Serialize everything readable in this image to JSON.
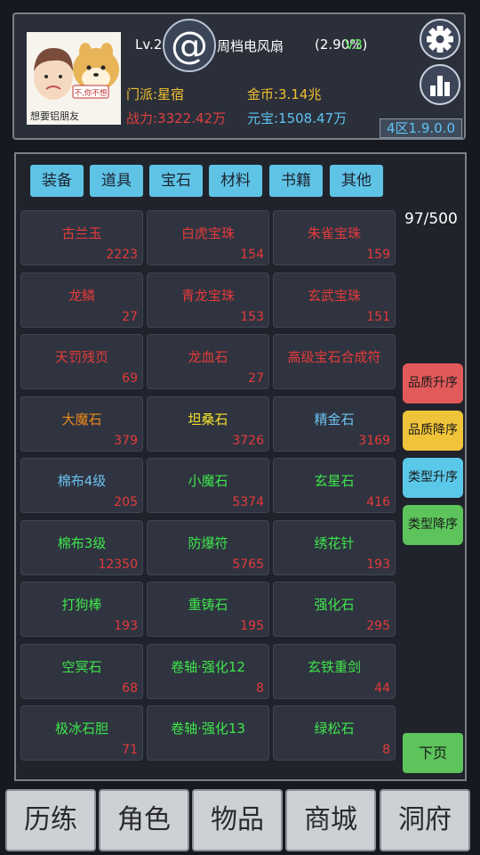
{
  "header": {
    "avatar_caption": "想要铝朋友",
    "avatar_sign": "不,你不想",
    "at_symbol": "@",
    "level": "Lv.2",
    "item_name": "周档电风扇",
    "item_pct": "(2.90%)",
    "vip": "V3",
    "sect": "门派:星宿",
    "gold": "金币:3.14兆",
    "power": "战力:3322.42万",
    "yuanbao": "元宝:1508.47万",
    "version": "4区1.9.0.0",
    "settings_icon": "gear-icon",
    "stats_icon": "bar-chart-icon"
  },
  "tabs": [
    "装备",
    "道具",
    "宝石",
    "材料",
    "书籍",
    "其他"
  ],
  "capacity": "97/500",
  "items": [
    {
      "name": "古兰玉",
      "count": "2223",
      "quality": "red"
    },
    {
      "name": "白虎宝珠",
      "count": "154",
      "quality": "red"
    },
    {
      "name": "朱雀宝珠",
      "count": "159",
      "quality": "red"
    },
    {
      "name": "龙鳞",
      "count": "27",
      "quality": "red"
    },
    {
      "name": "青龙宝珠",
      "count": "153",
      "quality": "red"
    },
    {
      "name": "玄武宝珠",
      "count": "151",
      "quality": "red"
    },
    {
      "name": "天罚残页",
      "count": "69",
      "quality": "red"
    },
    {
      "name": "龙血石",
      "count": "27",
      "quality": "red"
    },
    {
      "name": "高级宝石合成符",
      "count": "",
      "quality": "red"
    },
    {
      "name": "大魔石",
      "count": "379",
      "quality": "orange"
    },
    {
      "name": "坦桑石",
      "count": "3726",
      "quality": "yellow"
    },
    {
      "name": "精金石",
      "count": "3169",
      "quality": "blue"
    },
    {
      "name": "棉布4级",
      "count": "205",
      "quality": "blue"
    },
    {
      "name": "小魔石",
      "count": "5374",
      "quality": "green"
    },
    {
      "name": "玄星石",
      "count": "416",
      "quality": "green"
    },
    {
      "name": "棉布3级",
      "count": "12350",
      "quality": "green"
    },
    {
      "name": "防爆符",
      "count": "5765",
      "quality": "green"
    },
    {
      "name": "绣花针",
      "count": "193",
      "quality": "green"
    },
    {
      "name": "打狗棒",
      "count": "193",
      "quality": "green"
    },
    {
      "name": "重铸石",
      "count": "195",
      "quality": "green"
    },
    {
      "name": "强化石",
      "count": "295",
      "quality": "green"
    },
    {
      "name": "空冥石",
      "count": "68",
      "quality": "green"
    },
    {
      "name": "卷轴·强化12",
      "count": "8",
      "quality": "green"
    },
    {
      "name": "玄铁重剑",
      "count": "44",
      "quality": "green"
    },
    {
      "name": "极冰石胆",
      "count": "71",
      "quality": "green"
    },
    {
      "name": "卷轴·强化13",
      "count": "",
      "quality": "green"
    },
    {
      "name": "绿松石",
      "count": "8",
      "quality": "green"
    }
  ],
  "sort_buttons": [
    {
      "label": "品质升序",
      "color": "#e35a5a"
    },
    {
      "label": "品质降序",
      "color": "#f0c43a"
    },
    {
      "label": "类型升序",
      "color": "#5ac8e8"
    },
    {
      "label": "类型降序",
      "color": "#5cc45a"
    }
  ],
  "next_page": "下页",
  "nav": [
    "历练",
    "角色",
    "物品",
    "商城",
    "洞府"
  ],
  "colors": {
    "quality_red": "#e53a3a",
    "quality_orange": "#ef8a1c",
    "quality_yellow": "#f3e02a",
    "quality_blue": "#6cc3f0",
    "quality_green": "#3ee64a",
    "tab_bg": "#5fc3e6"
  }
}
